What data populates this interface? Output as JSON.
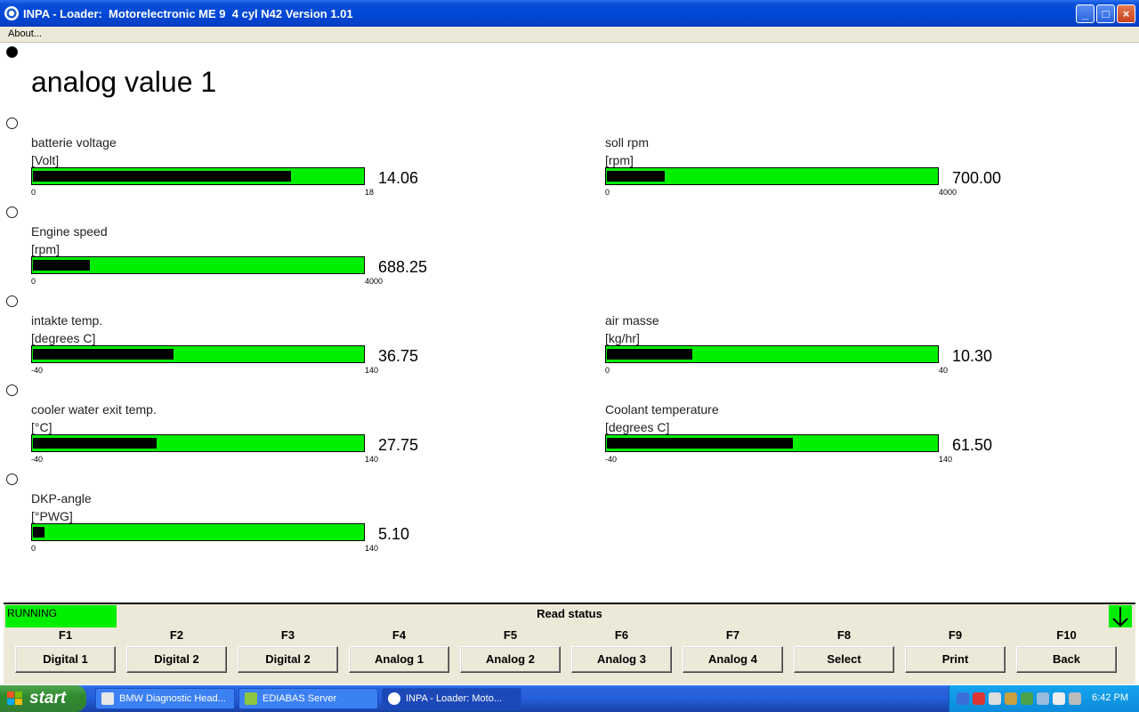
{
  "window": {
    "title": "INPA - Loader:  Motorelectronic ME 9  4 cyl N42 Version 1.01",
    "minimize": "_",
    "maximize": "□",
    "close": "×"
  },
  "menu": {
    "about": "About..."
  },
  "page": {
    "title": "analog value 1"
  },
  "gauges": [
    {
      "label": "batterie voltage",
      "unit": "[Volt]",
      "min": "0",
      "max": "18",
      "value": "14.06",
      "fraction": 0.781
    },
    {
      "label": "soll rpm",
      "unit": "[rpm]",
      "min": "0",
      "max": "4000",
      "value": "700.00",
      "fraction": 0.175
    },
    {
      "label": "Engine speed",
      "unit": "[rpm]",
      "min": "0",
      "max": "4000",
      "value": "688.25",
      "fraction": 0.172
    },
    {
      "label": "intakte temp.",
      "unit": "[degrees C]",
      "min": "-40",
      "max": "140",
      "value": "36.75",
      "fraction": 0.426
    },
    {
      "label": "air masse",
      "unit": "[kg/hr]",
      "min": "0",
      "max": "40",
      "value": "10.30",
      "fraction": 0.258
    },
    {
      "label": "cooler water exit temp.",
      "unit": "[°C]",
      "min": "-40",
      "max": "140",
      "value": "27.75",
      "fraction": 0.376
    },
    {
      "label": "Coolant temperature",
      "unit": "[degrees C]",
      "min": "-40",
      "max": "140",
      "value": "61.50",
      "fraction": 0.564
    },
    {
      "label": "DKP-angle",
      "unit": "[°PWG]",
      "min": "0",
      "max": "140",
      "value": "5.10",
      "fraction": 0.036
    }
  ],
  "status": {
    "running": "RUNNING",
    "read_status": "Read status"
  },
  "fkeys": [
    {
      "key": "F1",
      "label": "Digital 1"
    },
    {
      "key": "F2",
      "label": "Digital 2"
    },
    {
      "key": "F3",
      "label": "Digital 2"
    },
    {
      "key": "F4",
      "label": "Analog 1"
    },
    {
      "key": "F5",
      "label": "Analog 2"
    },
    {
      "key": "F6",
      "label": "Analog 3"
    },
    {
      "key": "F7",
      "label": "Analog 4"
    },
    {
      "key": "F8",
      "label": "Select"
    },
    {
      "key": "F9",
      "label": "Print"
    },
    {
      "key": "F10",
      "label": "Back"
    }
  ],
  "taskbar": {
    "start": "start",
    "tasks": [
      "BMW Diagnostic Head...",
      "EDIABAS Server",
      "INPA - Loader:  Moto..."
    ],
    "clock": "6:42 PM"
  },
  "colors": {
    "gauge_green": "#00ee00",
    "gauge_fill": "#000000",
    "titlebar_blue": "#0046d5"
  }
}
